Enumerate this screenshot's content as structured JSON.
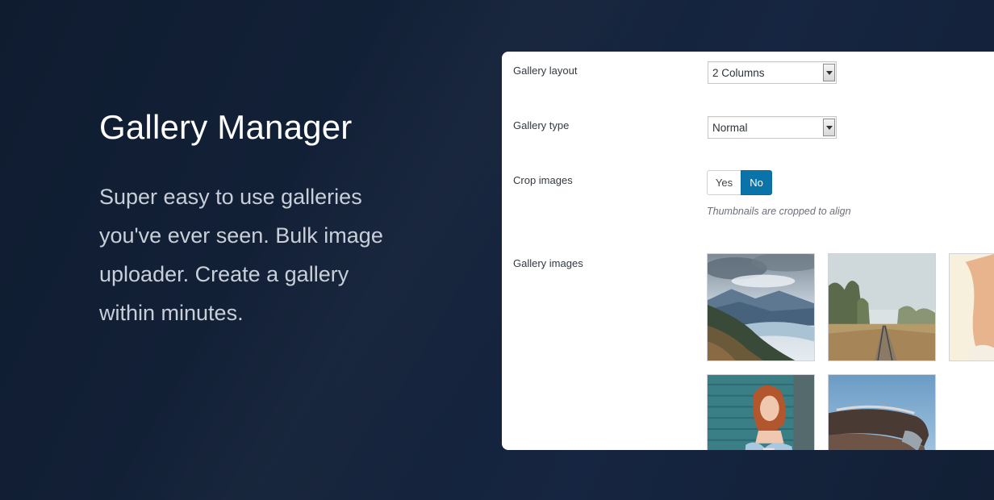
{
  "hero": {
    "title": "Gallery Manager",
    "description": "Super easy to use galleries you've ever seen. Bulk image uploader. Create a gallery within minutes."
  },
  "settings": {
    "gallery_layout": {
      "label": "Gallery layout",
      "value": "2 Columns"
    },
    "gallery_type": {
      "label": "Gallery type",
      "value": "Normal"
    },
    "crop_images": {
      "label": "Crop images",
      "options": [
        "Yes",
        "No"
      ],
      "selected": "No",
      "hint": "Thumbnails are cropped to align"
    },
    "gallery_images": {
      "label": "Gallery images",
      "images": [
        "mountain-lake-image",
        "railway-tracks-image",
        "woman-beach-image",
        "woman-denim-image",
        "vintage-car-image"
      ]
    }
  },
  "colors": {
    "background": "#14223a",
    "accent": "#0a73aa",
    "panel": "#ffffff"
  }
}
